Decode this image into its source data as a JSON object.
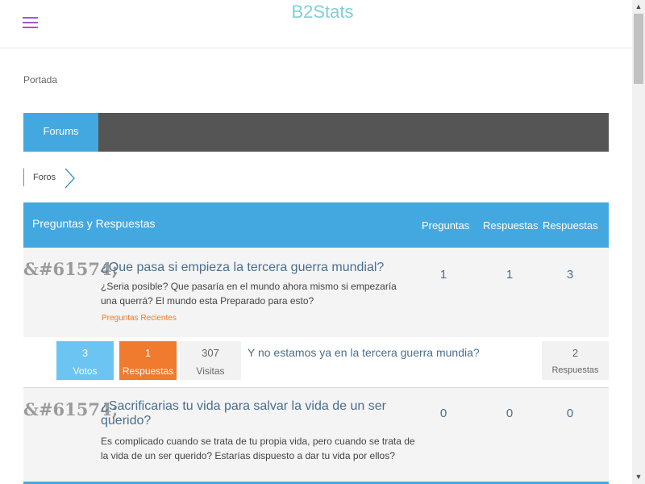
{
  "header": {
    "brand": "B2Stats",
    "menu_icon": "hamburger-menu-icon"
  },
  "breadcrumb_top": {
    "label": "Portada"
  },
  "nav": {
    "tabs": [
      {
        "label": "Forums",
        "active": true
      }
    ]
  },
  "breadcrumb": {
    "label": "Foros"
  },
  "forum": {
    "title": "Preguntas y Respuestas",
    "columns": [
      "Preguntas",
      "Respuestas",
      "Respuestas"
    ],
    "topics": [
      {
        "glyph": "&#61574;",
        "title": "¿Que pasa si empieza la tercera guerra mundial?",
        "description": "¿Seria posible? Que pasaría en el mundo ahora mismo si empezaría una querrá? El mundo esta Preparado para esto?",
        "link": "Preguntas Recientes",
        "counts": [
          "1",
          "1",
          "3"
        ],
        "latest": {
          "votes": "3",
          "votes_label": "Votos",
          "answers": "1",
          "answers_label": "Respuestas",
          "views": "307",
          "views_label": "Visitas",
          "title": "Y no estamos ya en la tercera guerra mundia?",
          "replies": "2",
          "replies_label": "Respuestas"
        }
      },
      {
        "glyph": "&#61574;",
        "title": "¿Sacrificarias tu vida para salvar la vida de un ser querido?",
        "description": "Es complicado cuando se trata de tu propia vida, pero cuando se trata de la vida de un ser querido? Estarías dispuesto a dar tu vida por ellos?",
        "counts": [
          "0",
          "0",
          "0"
        ]
      }
    ]
  },
  "colors": {
    "accent": "#44a8e0",
    "navbar": "#555555",
    "orange": "#f07a2e",
    "brand": "#7fd0d6",
    "menu": "#9b59d6"
  }
}
